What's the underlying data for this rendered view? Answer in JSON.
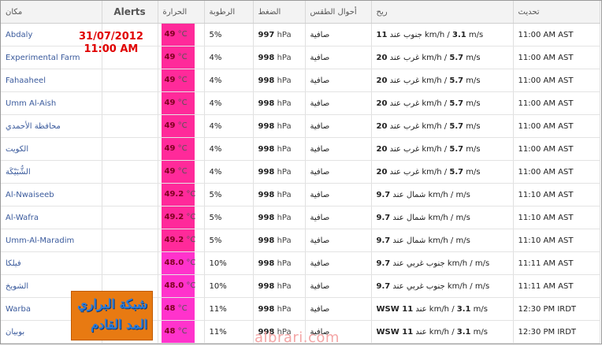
{
  "headers": {
    "location": "مكان",
    "alerts": "Alerts",
    "temperature": "الحرارة",
    "humidity": "الرطوبة",
    "pressure": "الضغط",
    "conditions": "أحوال الطقس",
    "wind": "ريح",
    "updated": "تحديث"
  },
  "overlay": {
    "date": "31/07/2012",
    "time": "11:00 AM"
  },
  "logo": {
    "line1": "شبكة البراري",
    "line2": "المد القادم"
  },
  "watermark": "albrari.com",
  "colors": {
    "hot": "#ff2a9a",
    "warm": "#ff33cc",
    "link": "#3a5a9c"
  },
  "rows": [
    {
      "location": "Abdaly",
      "temp": "49",
      "unit": "°C",
      "humidity": "5%",
      "pressure": "997",
      "punit": "hPa",
      "conditions": "صافية",
      "wind_lead": "11",
      "wind_dir": "جنوب عند",
      "wind_mid": "km/h /",
      "wind_speed": "3.1",
      "wind_unit": "m/s",
      "updated": "11:00 AM AST",
      "tempColor": "#ff2a9a"
    },
    {
      "location": "Experimental Farm",
      "temp": "49",
      "unit": "°C",
      "humidity": "4%",
      "pressure": "998",
      "punit": "hPa",
      "conditions": "صافية",
      "wind_lead": "20",
      "wind_dir": "غرب عند",
      "wind_mid": "km/h /",
      "wind_speed": "5.7",
      "wind_unit": "m/s",
      "updated": "11:00 AM AST",
      "tempColor": "#ff2a9a"
    },
    {
      "location": "Fahaaheel",
      "temp": "49",
      "unit": "°C",
      "humidity": "4%",
      "pressure": "998",
      "punit": "hPa",
      "conditions": "صافية",
      "wind_lead": "20",
      "wind_dir": "غرب عند",
      "wind_mid": "km/h /",
      "wind_speed": "5.7",
      "wind_unit": "m/s",
      "updated": "11:00 AM AST",
      "tempColor": "#ff2a9a"
    },
    {
      "location": "Umm Al-Aish",
      "temp": "49",
      "unit": "°C",
      "humidity": "4%",
      "pressure": "998",
      "punit": "hPa",
      "conditions": "صافية",
      "wind_lead": "20",
      "wind_dir": "غرب عند",
      "wind_mid": "km/h /",
      "wind_speed": "5.7",
      "wind_unit": "m/s",
      "updated": "11:00 AM AST",
      "tempColor": "#ff2a9a"
    },
    {
      "location": "محافظة الأحمدي",
      "temp": "49",
      "unit": "°C",
      "humidity": "4%",
      "pressure": "998",
      "punit": "hPa",
      "conditions": "صافية",
      "wind_lead": "20",
      "wind_dir": "غرب عند",
      "wind_mid": "km/h /",
      "wind_speed": "5.7",
      "wind_unit": "m/s",
      "updated": "11:00 AM AST",
      "tempColor": "#ff2a9a"
    },
    {
      "location": "الكويت",
      "temp": "49",
      "unit": "°C",
      "humidity": "4%",
      "pressure": "998",
      "punit": "hPa",
      "conditions": "صافية",
      "wind_lead": "20",
      "wind_dir": "غرب عند",
      "wind_mid": "km/h /",
      "wind_speed": "5.7",
      "wind_unit": "m/s",
      "updated": "11:00 AM AST",
      "tempColor": "#ff2a9a"
    },
    {
      "location": "الشُّبَيْكَة",
      "temp": "49",
      "unit": "°C",
      "humidity": "4%",
      "pressure": "998",
      "punit": "hPa",
      "conditions": "صافية",
      "wind_lead": "20",
      "wind_dir": "غرب عند",
      "wind_mid": "km/h /",
      "wind_speed": "5.7",
      "wind_unit": "m/s",
      "updated": "11:00 AM AST",
      "tempColor": "#ff2a9a"
    },
    {
      "location": "Al-Nwaiseeb",
      "temp": "49.2",
      "unit": "°C",
      "humidity": "5%",
      "pressure": "998",
      "punit": "hPa",
      "conditions": "صافية",
      "wind_lead": "9.7",
      "wind_dir": "شمال عند",
      "wind_mid": "km/h /",
      "wind_speed": "",
      "wind_unit": "m/s",
      "updated": "11:10 AM AST",
      "tempColor": "#ff2a9a"
    },
    {
      "location": "Al-Wafra",
      "temp": "49.2",
      "unit": "°C",
      "humidity": "5%",
      "pressure": "998",
      "punit": "hPa",
      "conditions": "صافية",
      "wind_lead": "9.7",
      "wind_dir": "شمال عند",
      "wind_mid": "km/h /",
      "wind_speed": "",
      "wind_unit": "m/s",
      "updated": "11:10 AM AST",
      "tempColor": "#ff2a9a"
    },
    {
      "location": "Umm-Al-Maradim",
      "temp": "49.2",
      "unit": "°C",
      "humidity": "5%",
      "pressure": "998",
      "punit": "hPa",
      "conditions": "صافية",
      "wind_lead": "9.7",
      "wind_dir": "شمال عند",
      "wind_mid": "km/h /",
      "wind_speed": "",
      "wind_unit": "m/s",
      "updated": "11:10 AM AST",
      "tempColor": "#ff2a9a"
    },
    {
      "location": "فيلكا",
      "temp": "48.0",
      "unit": "°C",
      "humidity": "10%",
      "pressure": "998",
      "punit": "hPa",
      "conditions": "صافية",
      "wind_lead": "9.7",
      "wind_dir": "جنوب غربي عند",
      "wind_mid": "km/h /",
      "wind_speed": "",
      "wind_unit": "m/s",
      "updated": "11:11 AM AST",
      "tempColor": "#ff33cc"
    },
    {
      "location": "الشويخ",
      "temp": "48.0",
      "unit": "°C",
      "humidity": "10%",
      "pressure": "998",
      "punit": "hPa",
      "conditions": "صافية",
      "wind_lead": "9.7",
      "wind_dir": "جنوب غربي عند",
      "wind_mid": "km/h /",
      "wind_speed": "",
      "wind_unit": "m/s",
      "updated": "11:11 AM AST",
      "tempColor": "#ff33cc"
    },
    {
      "location": "Warba",
      "temp": "48",
      "unit": "°C",
      "humidity": "11%",
      "pressure": "998",
      "punit": "hPa",
      "conditions": "صافية",
      "wind_lead": "WSW 11",
      "wind_dir": "عند",
      "wind_mid": "km/h /",
      "wind_speed": "3.1",
      "wind_unit": "m/s",
      "updated": "12:30 PM IRDT",
      "tempColor": "#ff33cc"
    },
    {
      "location": "بوبيان",
      "temp": "48",
      "unit": "°C",
      "humidity": "11%",
      "pressure": "998",
      "punit": "hPa",
      "conditions": "صافية",
      "wind_lead": "WSW 11",
      "wind_dir": "عند",
      "wind_mid": "km/h /",
      "wind_speed": "3.1",
      "wind_unit": "m/s",
      "updated": "12:30 PM IRDT",
      "tempColor": "#ff33cc"
    }
  ]
}
